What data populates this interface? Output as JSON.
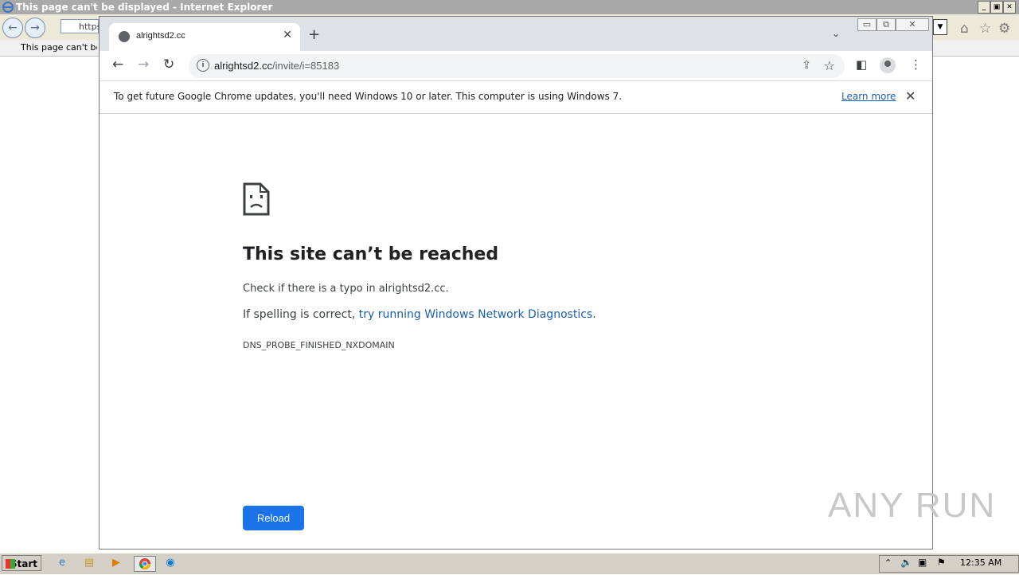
{
  "ie": {
    "window_title": "This page can't be displayed - Internet Explorer",
    "address_partial": "https:",
    "tab_title": "This page can't be d",
    "minimize": "_",
    "restore": "▣",
    "close": "✕"
  },
  "chrome": {
    "tab_title": "alrightsd2.cc",
    "new_tab": "+",
    "url_host": "alrightsd2.cc",
    "url_path": "/invite/i=85183",
    "infobar_message": "To get future Google Chrome updates, you'll need Windows 10 or later. This computer is using Windows 7.",
    "infobar_link": "Learn more",
    "error": {
      "headline": "This site can’t be reached",
      "check_text": "Check if there is a typo in alrightsd2.cc.",
      "spelling_prefix": "If spelling is correct, ",
      "spelling_link": "try running Windows Network Diagnostics",
      "spelling_suffix": ".",
      "code": "DNS_PROBE_FINISHED_NXDOMAIN",
      "reload_label": "Reload"
    }
  },
  "watermark": "ANY RUN",
  "taskbar": {
    "start_label": "Start",
    "clock": "12:35 AM"
  },
  "icons": {
    "back": "←",
    "forward": "→",
    "reload": "↻",
    "star": "☆",
    "menu": "⋮",
    "share": "⇪",
    "close": "✕",
    "tab_search": "⌄",
    "side_panel": "◧"
  },
  "colors": {
    "accent": "#1a73e8",
    "link": "#1a5fb4",
    "tabstrip": "#dee1e6"
  }
}
